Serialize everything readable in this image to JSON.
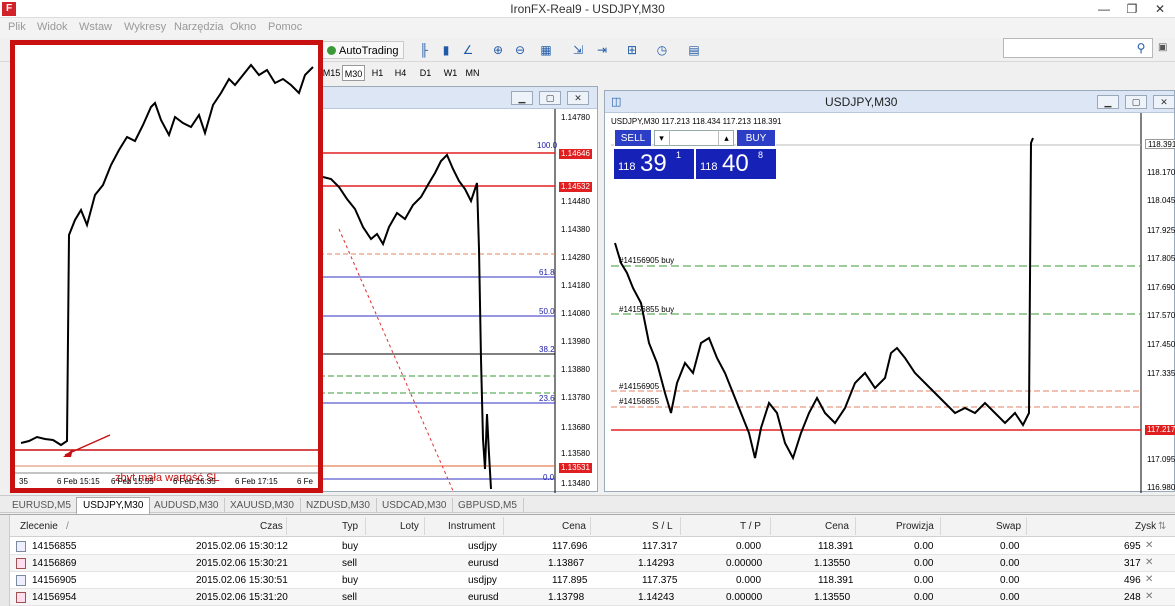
{
  "window": {
    "title": "IronFX-Real9 - USDJPY,M30",
    "app_icon": "F",
    "controls": [
      "—",
      "❐",
      "✕"
    ]
  },
  "menu": [
    "Plik",
    "Widok",
    "Wstaw",
    "Wykresy",
    "Narzędzia",
    "Okno",
    "Pomoc"
  ],
  "toolbar": {
    "autotrading_label": "AutoTrading",
    "search_placeholder": ""
  },
  "timeframes": {
    "items": [
      "M15",
      "M30",
      "H1",
      "H4",
      "D1",
      "W1",
      "MN"
    ],
    "active": "M30"
  },
  "overlay_chart": {
    "annotation": "zbyt mała wartość SL",
    "time_labels": [
      "35",
      "6 Feb 15:15",
      "6 Feb 15:55",
      "6 Feb 16:35",
      "6 Feb 17:15",
      "6 Fe"
    ]
  },
  "middle_chart": {
    "prices": [
      "1.14780",
      "1.14646",
      "1.14532",
      "1.14480",
      "1.14380",
      "1.14280",
      "1.14180",
      "1.14080",
      "1.13980",
      "1.13880",
      "1.13780",
      "1.13680",
      "1.13580",
      "1.13531",
      "1.13480"
    ],
    "fib_labels": [
      "100.0",
      "61.8",
      "50.0",
      "38.2",
      "23.6",
      "0.0"
    ],
    "level_tags": [
      "1.14646",
      "1.14532",
      "1.13531"
    ]
  },
  "usdjpy_chart": {
    "title": "USDJPY,M30",
    "header": "USDJPY,M30  117.213 118.434 117.213 118.391",
    "sell_label": "SELL",
    "buy_label": "BUY",
    "sell_price": {
      "prefix": "118",
      "big": "39",
      "sup": "1"
    },
    "buy_price": {
      "prefix": "118",
      "big": "40",
      "sup": "8"
    },
    "order_labels": [
      "#14156905 buy",
      "#14156855 buy",
      "#14156905",
      "#14156855"
    ],
    "prices": [
      "118.391",
      "118.170",
      "118.045",
      "117.925",
      "117.805",
      "117.690",
      "117.570",
      "117.450",
      "117.335",
      "117.215",
      "117.095",
      "116.980"
    ],
    "current_price": "118.391",
    "sl_price": "117.217"
  },
  "symbol_tabs": {
    "items": [
      "EURUSD,M5",
      "USDJPY,M30",
      "AUDUSD,M30",
      "XAUUSD,M30",
      "NZDUSD,M30",
      "USDCAD,M30",
      "GBPUSD,M5"
    ],
    "active": "USDJPY,M30"
  },
  "orders": {
    "columns": [
      "Zlecenie",
      "/",
      "Czas",
      "Typ",
      "Loty",
      "Instrument",
      "Cena",
      "S / L",
      "T / P",
      "Cena",
      "Prowizja",
      "Swap",
      "Zysk"
    ],
    "rows": [
      {
        "order": "14156855",
        "time": "2015.02.06 15:30:12",
        "type": "buy",
        "lots": "",
        "instrument": "usdjpy",
        "price": "117.696",
        "sl": "117.317",
        "tp": "0.000",
        "price2": "118.391",
        "commission": "0.00",
        "swap": "0.00",
        "profit": "695"
      },
      {
        "order": "14156869",
        "time": "2015.02.06 15:30:21",
        "type": "sell",
        "lots": "",
        "instrument": "eurusd",
        "price": "1.13867",
        "sl": "1.14293",
        "tp": "0.00000",
        "price2": "1.13550",
        "commission": "0.00",
        "swap": "0.00",
        "profit": "317"
      },
      {
        "order": "14156905",
        "time": "2015.02.06 15:30:51",
        "type": "buy",
        "lots": "",
        "instrument": "usdjpy",
        "price": "117.895",
        "sl": "117.375",
        "tp": "0.000",
        "price2": "118.391",
        "commission": "0.00",
        "swap": "0.00",
        "profit": "496"
      },
      {
        "order": "14156954",
        "time": "2015.02.06 15:31:20",
        "type": "sell",
        "lots": "",
        "instrument": "eurusd",
        "price": "1.13798",
        "sl": "1.14243",
        "tp": "0.00000",
        "price2": "1.13550",
        "commission": "0.00",
        "swap": "0.00",
        "profit": "248"
      }
    ],
    "close_glyph": "✕"
  },
  "colors": {
    "accent_red": "#c81010",
    "sell_blue": "#1621b8",
    "level_red": "#e02020",
    "fib_blue": "#1a1aaa",
    "green_dash": "#3a9a3a"
  }
}
